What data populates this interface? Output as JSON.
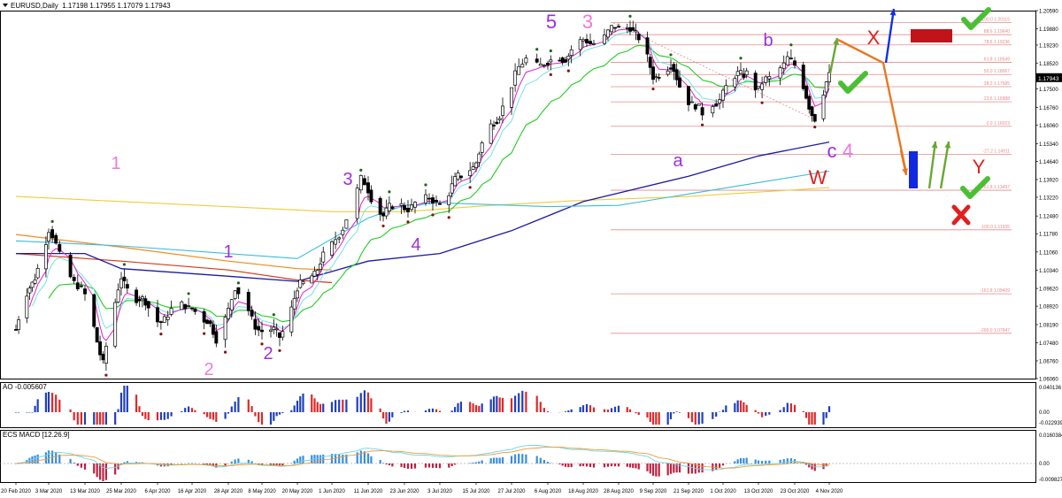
{
  "header": {
    "symbol": "EURUSD,Daily",
    "ohlc": "1.17198 1.17955 1.17079 1.17943"
  },
  "ao_header": "AO -0.005607",
  "macd_header": "ECS MACD [12.26.9]",
  "colors": {
    "bull_bar": "#1f3fbf",
    "bear_bar": "#e02828",
    "fib": "#e98a8a",
    "sma_blue": "#1a1aa6",
    "sma_cyan": "#3bbcdc",
    "sma_yellow": "#f0cc3a",
    "sma_orange": "#ef8a1a",
    "sma_red": "#d63a1a",
    "ema_green": "#22cc22",
    "ema_magenta": "#e020c8",
    "ema_aqua": "#66e0e0",
    "wave_purple": "#9b30d9",
    "wave_pink": "#ee7ad8",
    "wave_red": "#e02020",
    "projection_orange": "#e97720",
    "projection_blue": "#1030e0",
    "projection_green": "#66a832",
    "check_green": "#4bbf34",
    "cross_red": "#e02020",
    "zone_red": "#c0141a",
    "zone_blue": "#1028e0"
  },
  "chart_data": {
    "type": "candlestick",
    "symbol": "EURUSD",
    "timeframe": "Daily",
    "ylim": [
      1.0606,
      1.2059
    ],
    "y_ticks": [
      "1.20590",
      "1.19880",
      "1.19230",
      "1.18520",
      "1.17943",
      "1.17500",
      "1.16760",
      "1.16060",
      "1.15340",
      "1.14640",
      "1.13920",
      "1.13220",
      "1.12480",
      "1.11780",
      "1.11060",
      "1.10340",
      "1.09620",
      "1.08920",
      "1.08190",
      "1.07480",
      "1.06760",
      "1.06060"
    ],
    "current_price": "1.17943",
    "x_ticks": [
      "20 Feb 2020",
      "3 Mar 2020",
      "13 Mar 2020",
      "25 Mar 2020",
      "6 Apr 2020",
      "16 Apr 2020",
      "28 Apr 2020",
      "8 May 2020",
      "20 May 2020",
      "1 Jun 2020",
      "11 Jun 2020",
      "23 Jun 2020",
      "3 Jul 2020",
      "15 Jul 2020",
      "27 Jul 2020",
      "6 Aug 2020",
      "18 Aug 2020",
      "28 Aug 2020",
      "9 Sep 2020",
      "21 Sep 2020",
      "1 Oct 2020",
      "13 Oct 2020",
      "23 Oct 2020",
      "4 Nov 2020"
    ],
    "price_path": [
      [
        "20 Feb 2020",
        1.08
      ],
      [
        "3 Mar 2020",
        1.118
      ],
      [
        "13 Mar 2020",
        1.092
      ],
      [
        "19 Mar 2020",
        1.068
      ],
      [
        "25 Mar 2020",
        1.1
      ],
      [
        "6 Apr 2020",
        1.084
      ],
      [
        "16 Apr 2020",
        1.09
      ],
      [
        "24 Apr 2020",
        1.077
      ],
      [
        "30 Apr 2020",
        1.095
      ],
      [
        "8 May 2020",
        1.079
      ],
      [
        "14 May 2020",
        1.078
      ],
      [
        "20 May 2020",
        1.095
      ],
      [
        "1 Jun 2020",
        1.112
      ],
      [
        "9 Jun 2020",
        1.138
      ],
      [
        "16 Jun 2020",
        1.126
      ],
      [
        "23 Jun 2020",
        1.129
      ],
      [
        "3 Jul 2020",
        1.131
      ],
      [
        "15 Jul 2020",
        1.147
      ],
      [
        "27 Jul 2020",
        1.176
      ],
      [
        "31 Jul 2020",
        1.188
      ],
      [
        "6 Aug 2020",
        1.184
      ],
      [
        "18 Aug 2020",
        1.193
      ],
      [
        "1 Sep 2020",
        1.201
      ],
      [
        "9 Sep 2020",
        1.181
      ],
      [
        "15 Sep 2020",
        1.183
      ],
      [
        "25 Sep 2020",
        1.164
      ],
      [
        "1 Oct 2020",
        1.174
      ],
      [
        "9 Oct 2020",
        1.183
      ],
      [
        "13 Oct 2020",
        1.174
      ],
      [
        "21 Oct 2020",
        1.188
      ],
      [
        "30 Oct 2020",
        1.164
      ],
      [
        "4 Nov 2020",
        1.179
      ]
    ],
    "indicators": [
      "SMA 200 (yellow)",
      "SMA 144 (orange)",
      "SMA 233 (red)",
      "SMA (blue)",
      "SMA (cyan)",
      "EMA 21 (green)",
      "EMA 5 (magenta)",
      "EMA (aqua)"
    ],
    "fibonacci": [
      {
        "label": "100.0",
        "price": "1.20115"
      },
      {
        "label": "88.6",
        "price": "1.19640"
      },
      {
        "label": "78.6",
        "price": "1.19236"
      },
      {
        "label": "61.8",
        "price": "1.18549"
      },
      {
        "label": "50.0",
        "price": "1.18067"
      },
      {
        "label": "38.2",
        "price": "1.17585"
      },
      {
        "label": "23.6",
        "price": "1.16988"
      },
      {
        "label": "0.0",
        "price": "1.16023"
      },
      {
        "label": "-27.2",
        "price": "1.14911"
      },
      {
        "label": "-61.8",
        "price": "1.13497"
      },
      {
        "label": "-100.0",
        "price": "1.11935"
      },
      {
        "label": "-161.8",
        "price": "1.09409"
      },
      {
        "label": "-200.0",
        "price": "1.07847"
      }
    ],
    "wave_labels": [
      "1",
      "2",
      "1",
      "2",
      "3",
      "4",
      "5",
      "3",
      "b",
      "a",
      "c",
      "4",
      "W",
      "X",
      "Y"
    ],
    "ao": {
      "label": "AO",
      "value": "-0.005607",
      "y_ticks": [
        "0.040136",
        "0.00",
        "-0.022939"
      ]
    },
    "macd": {
      "label": "ECS MACD",
      "params": "12.26.9",
      "y_ticks": [
        "0.0160384",
        "0.00",
        "-0.009827"
      ]
    }
  }
}
